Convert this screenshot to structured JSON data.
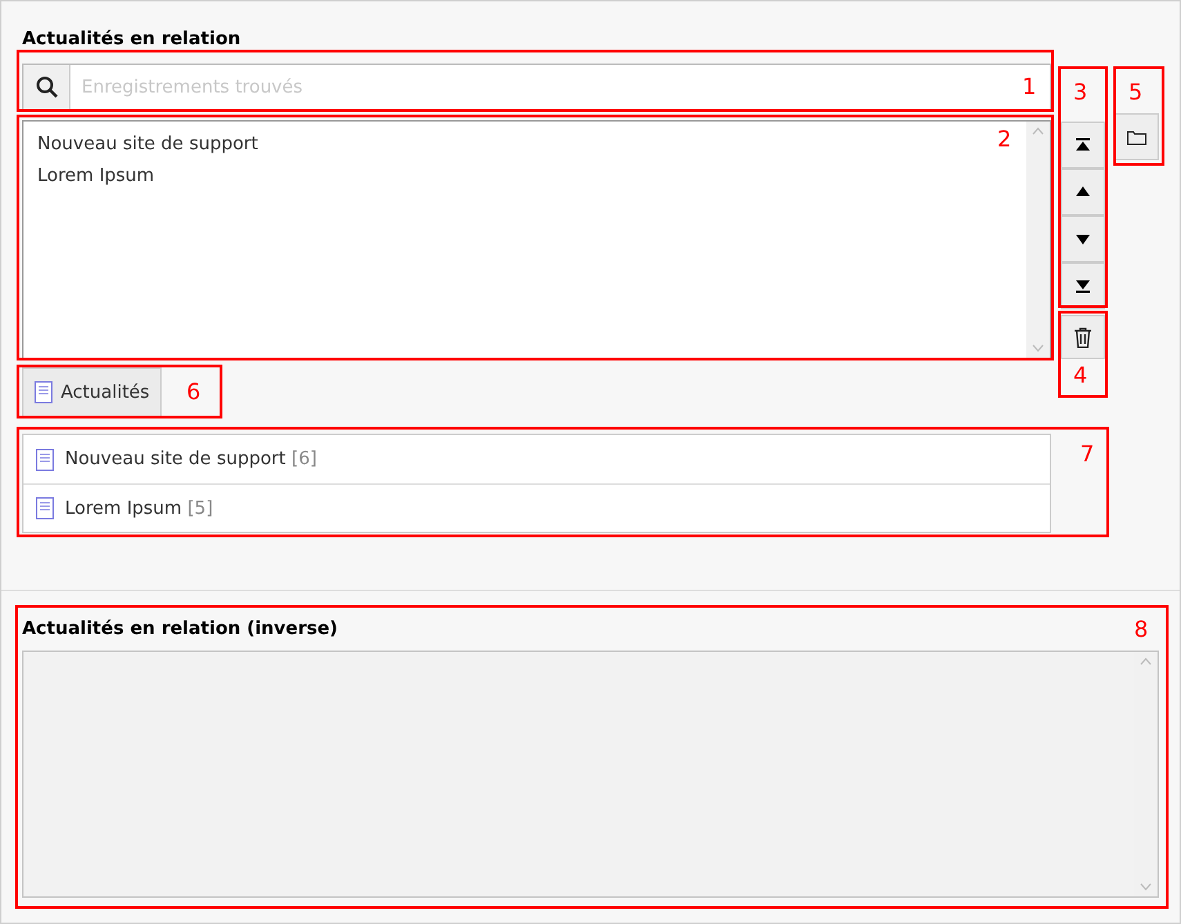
{
  "relation": {
    "title": "Actualités en relation",
    "search": {
      "placeholder": "Enregistrements trouvés"
    },
    "selected_items": [
      {
        "label": "Nouveau site de support"
      },
      {
        "label": "Lorem Ipsum"
      }
    ],
    "add_table_button": {
      "label": "Actualités"
    },
    "results": [
      {
        "title": "Nouveau site de support",
        "uid": "[6]"
      },
      {
        "title": "Lorem Ipsum",
        "uid": "[5]"
      }
    ]
  },
  "inverse": {
    "title": "Actualités en relation (inverse)",
    "disabled": true
  },
  "annotations": [
    {
      "label": "1"
    },
    {
      "label": "2"
    },
    {
      "label": "3"
    },
    {
      "label": "4"
    },
    {
      "label": "5"
    },
    {
      "label": "6"
    },
    {
      "label": "7"
    },
    {
      "label": "8"
    }
  ]
}
